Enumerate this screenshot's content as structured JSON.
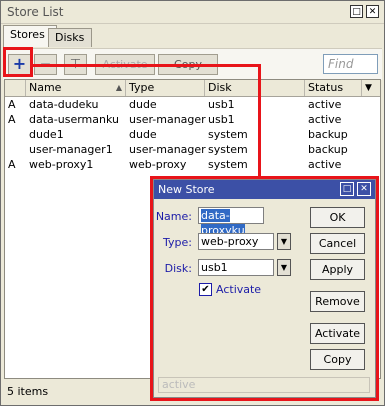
{
  "window": {
    "title": "Store List"
  },
  "tabs": [
    {
      "label": "Stores"
    },
    {
      "label": "Disks"
    }
  ],
  "toolbar": {
    "add_glyph": "+",
    "remove_glyph": "−",
    "filter_glyph": "⊤",
    "activate_label": "Activate",
    "copy_label": "Copy",
    "find_placeholder": "Find"
  },
  "table": {
    "columns": [
      "Name",
      "Type",
      "Disk",
      "Status"
    ],
    "rows": [
      {
        "flag": "A",
        "name": "data-dudeku",
        "type": "dude",
        "disk": "usb1",
        "status": "active"
      },
      {
        "flag": "A",
        "name": "data-usermanku",
        "type": "user-manager",
        "disk": "usb1",
        "status": "active"
      },
      {
        "flag": "",
        "name": "dude1",
        "type": "dude",
        "disk": "system",
        "status": "backup"
      },
      {
        "flag": "",
        "name": "user-manager1",
        "type": "user-manager",
        "disk": "system",
        "status": "backup"
      },
      {
        "flag": "A",
        "name": "web-proxy1",
        "type": "web-proxy",
        "disk": "system",
        "status": "active"
      }
    ]
  },
  "status_bar": {
    "text": "5 items"
  },
  "dialog": {
    "title": "New Store",
    "name_label": "Name:",
    "name_value": "data-proxyku",
    "type_label": "Type:",
    "type_value": "web-proxy",
    "disk_label": "Disk:",
    "disk_value": "usb1",
    "activate_checkbox_label": "Activate",
    "buttons": {
      "ok": "OK",
      "cancel": "Cancel",
      "apply": "Apply",
      "remove": "Remove",
      "activate": "Activate",
      "copy": "Copy"
    },
    "status_text": "active"
  },
  "colors": {
    "highlight": "#e8141a",
    "dialog_title_bg": "#3c50a6",
    "label_blue": "#1c1ca8"
  }
}
